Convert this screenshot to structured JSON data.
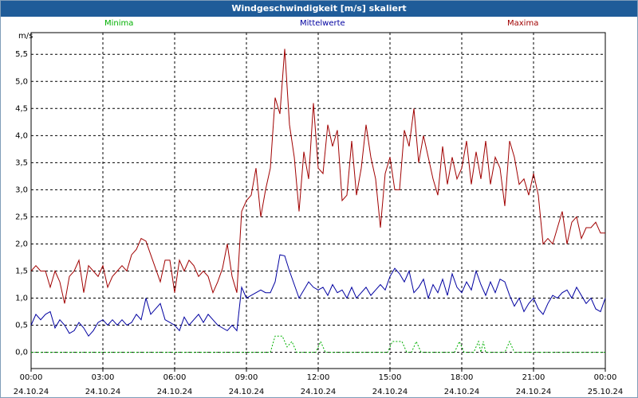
{
  "window": {
    "title": "Windgeschwindigkeit [m/s] skaliert"
  },
  "chart_data": {
    "type": "line",
    "title": "Windgeschwindigkeit [m/s] skaliert",
    "ylabel": "m/s",
    "ylim": [
      -0.3,
      5.9
    ],
    "xlim": [
      0,
      24
    ],
    "grid": true,
    "legend_placement": "top",
    "yticks": [
      "0,0",
      "0,5",
      "1,0",
      "1,5",
      "2,0",
      "2,5",
      "3,0",
      "3,5",
      "4,0",
      "4,5",
      "5,0",
      "5,5"
    ],
    "ytick_values": [
      0,
      0.5,
      1.0,
      1.5,
      2.0,
      2.5,
      3.0,
      3.5,
      4.0,
      4.5,
      5.0,
      5.5
    ],
    "xticks": [
      {
        "time": "00:00",
        "date": "24.10.24"
      },
      {
        "time": "03:00",
        "date": "24.10.24"
      },
      {
        "time": "06:00",
        "date": "24.10.24"
      },
      {
        "time": "09:00",
        "date": "24.10.24"
      },
      {
        "time": "12:00",
        "date": "24.10.24"
      },
      {
        "time": "15:00",
        "date": "24.10.24"
      },
      {
        "time": "18:00",
        "date": "24.10.24"
      },
      {
        "time": "21:00",
        "date": "24.10.24"
      },
      {
        "time": "00:00",
        "date": "25.10.24"
      }
    ],
    "xtick_values": [
      0,
      3,
      6,
      9,
      12,
      15,
      18,
      21,
      24
    ],
    "series": [
      {
        "name": "Minima",
        "color": "#00b000",
        "x": [
          0,
          10,
          10.2,
          10.5,
          10.7,
          10.9,
          11.1,
          11.9,
          12.1,
          12.3,
          14.9,
          15.1,
          15.5,
          15.7,
          15.9,
          16.1,
          16.3,
          17.7,
          17.9,
          18.1,
          18.5,
          18.7,
          18.8,
          18.9,
          19.0,
          19.1,
          19.3,
          19.8,
          20.0,
          20.2,
          24
        ],
        "y": [
          0,
          0,
          0.3,
          0.3,
          0.1,
          0.2,
          0,
          0,
          0.2,
          0,
          0,
          0.2,
          0.2,
          0,
          0,
          0.2,
          0,
          0,
          0.2,
          0,
          0,
          0.2,
          0,
          0.2,
          0,
          0,
          0,
          0,
          0.2,
          0,
          0
        ]
      },
      {
        "name": "Mittelwerte",
        "color": "#0000a0",
        "x": [
          0,
          0.2,
          0.4,
          0.6,
          0.8,
          1.0,
          1.2,
          1.4,
          1.6,
          1.8,
          2.0,
          2.2,
          2.4,
          2.6,
          2.8,
          3.0,
          3.2,
          3.4,
          3.6,
          3.8,
          4.0,
          4.2,
          4.4,
          4.6,
          4.8,
          5.0,
          5.2,
          5.4,
          5.6,
          5.8,
          6.0,
          6.2,
          6.4,
          6.6,
          6.8,
          7.0,
          7.2,
          7.4,
          7.6,
          7.8,
          8.0,
          8.2,
          8.4,
          8.6,
          8.8,
          9.0,
          9.2,
          9.4,
          9.6,
          9.8,
          10.0,
          10.2,
          10.4,
          10.6,
          10.8,
          11.0,
          11.2,
          11.4,
          11.6,
          11.8,
          12.0,
          12.2,
          12.4,
          12.6,
          12.8,
          13.0,
          13.2,
          13.4,
          13.6,
          13.8,
          14.0,
          14.2,
          14.4,
          14.6,
          14.8,
          15.0,
          15.2,
          15.4,
          15.6,
          15.8,
          16.0,
          16.2,
          16.4,
          16.6,
          16.8,
          17.0,
          17.2,
          17.4,
          17.6,
          17.8,
          18.0,
          18.2,
          18.4,
          18.6,
          18.8,
          19.0,
          19.2,
          19.4,
          19.6,
          19.8,
          20.0,
          20.2,
          20.4,
          20.6,
          20.8,
          21.0,
          21.2,
          21.4,
          21.6,
          21.8,
          22.0,
          22.2,
          22.4,
          22.6,
          22.8,
          23.0,
          23.2,
          23.4,
          23.6,
          23.8,
          24.0
        ],
        "y": [
          0.5,
          0.7,
          0.6,
          0.7,
          0.75,
          0.45,
          0.6,
          0.5,
          0.35,
          0.4,
          0.55,
          0.45,
          0.3,
          0.4,
          0.55,
          0.6,
          0.5,
          0.6,
          0.5,
          0.6,
          0.5,
          0.55,
          0.7,
          0.6,
          1.0,
          0.7,
          0.8,
          0.9,
          0.6,
          0.55,
          0.5,
          0.4,
          0.65,
          0.5,
          0.6,
          0.7,
          0.55,
          0.7,
          0.6,
          0.5,
          0.45,
          0.4,
          0.5,
          0.4,
          1.2,
          1.0,
          1.05,
          1.1,
          1.15,
          1.1,
          1.1,
          1.3,
          1.8,
          1.78,
          1.5,
          1.25,
          1.0,
          1.15,
          1.3,
          1.2,
          1.15,
          1.2,
          1.05,
          1.25,
          1.1,
          1.15,
          1.0,
          1.2,
          1.0,
          1.1,
          1.2,
          1.05,
          1.15,
          1.25,
          1.15,
          1.4,
          1.55,
          1.45,
          1.3,
          1.5,
          1.1,
          1.2,
          1.35,
          1.0,
          1.25,
          1.1,
          1.35,
          1.05,
          1.45,
          1.2,
          1.1,
          1.3,
          1.15,
          1.5,
          1.25,
          1.05,
          1.3,
          1.1,
          1.35,
          1.3,
          1.05,
          0.85,
          1.0,
          0.75,
          0.9,
          1.0,
          0.8,
          0.7,
          0.9,
          1.05,
          1.0,
          1.1,
          1.15,
          1.0,
          1.2,
          1.05,
          0.9,
          1.0,
          0.8,
          0.75,
          1.0
        ]
      },
      {
        "name": "Maxima",
        "color": "#a00000",
        "x": [
          0,
          0.2,
          0.4,
          0.6,
          0.8,
          1.0,
          1.2,
          1.4,
          1.6,
          1.8,
          2.0,
          2.2,
          2.4,
          2.6,
          2.8,
          3.0,
          3.2,
          3.4,
          3.6,
          3.8,
          4.0,
          4.2,
          4.4,
          4.6,
          4.8,
          5.0,
          5.2,
          5.4,
          5.6,
          5.8,
          6.0,
          6.2,
          6.4,
          6.6,
          6.8,
          7.0,
          7.2,
          7.4,
          7.6,
          7.8,
          8.0,
          8.2,
          8.4,
          8.6,
          8.8,
          9.0,
          9.2,
          9.4,
          9.6,
          9.8,
          10.0,
          10.2,
          10.4,
          10.6,
          10.8,
          11.0,
          11.2,
          11.4,
          11.6,
          11.8,
          12.0,
          12.2,
          12.4,
          12.6,
          12.8,
          13.0,
          13.2,
          13.4,
          13.6,
          13.8,
          14.0,
          14.2,
          14.4,
          14.6,
          14.8,
          15.0,
          15.2,
          15.4,
          15.6,
          15.8,
          16.0,
          16.2,
          16.4,
          16.6,
          16.8,
          17.0,
          17.2,
          17.4,
          17.6,
          17.8,
          18.0,
          18.2,
          18.4,
          18.6,
          18.8,
          19.0,
          19.2,
          19.4,
          19.6,
          19.8,
          20.0,
          20.2,
          20.4,
          20.6,
          20.8,
          21.0,
          21.2,
          21.4,
          21.6,
          21.8,
          22.0,
          22.2,
          22.4,
          22.6,
          22.8,
          23.0,
          23.2,
          23.4,
          23.6,
          23.8,
          24.0
        ],
        "y": [
          1.5,
          1.6,
          1.5,
          1.5,
          1.2,
          1.5,
          1.3,
          0.9,
          1.4,
          1.5,
          1.7,
          1.1,
          1.6,
          1.5,
          1.4,
          1.6,
          1.2,
          1.4,
          1.5,
          1.6,
          1.5,
          1.8,
          1.9,
          2.1,
          2.05,
          1.8,
          1.55,
          1.3,
          1.7,
          1.7,
          1.1,
          1.7,
          1.5,
          1.7,
          1.6,
          1.4,
          1.5,
          1.4,
          1.1,
          1.3,
          1.55,
          2.0,
          1.4,
          1.1,
          2.6,
          2.8,
          2.9,
          3.4,
          2.5,
          3.0,
          3.4,
          4.7,
          4.4,
          5.6,
          4.2,
          3.6,
          2.6,
          3.7,
          3.2,
          4.6,
          3.4,
          3.3,
          4.2,
          3.8,
          4.1,
          2.8,
          2.9,
          3.9,
          2.9,
          3.4,
          4.2,
          3.6,
          3.2,
          2.3,
          3.3,
          3.6,
          3.0,
          3.0,
          4.1,
          3.8,
          4.5,
          3.5,
          4.0,
          3.6,
          3.2,
          2.9,
          3.8,
          3.1,
          3.6,
          3.2,
          3.4,
          3.9,
          3.1,
          3.7,
          3.2,
          3.9,
          3.1,
          3.6,
          3.4,
          2.7,
          3.9,
          3.6,
          3.1,
          3.2,
          2.9,
          3.3,
          2.9,
          2.0,
          2.1,
          2.0,
          2.3,
          2.6,
          2.0,
          2.4,
          2.5,
          2.1,
          2.3,
          2.3,
          2.4,
          2.2,
          2.2
        ]
      }
    ]
  }
}
